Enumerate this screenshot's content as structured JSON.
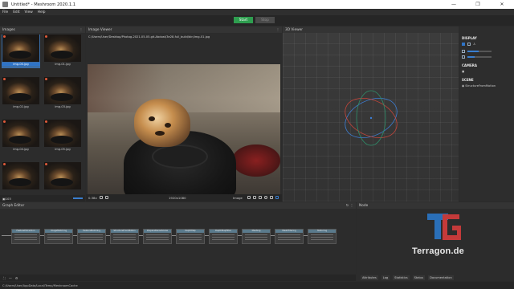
{
  "window": {
    "title": "Untitled* - Meshroom 2020.1.1",
    "controls": [
      "—",
      "❐",
      "✕"
    ]
  },
  "menu": [
    "File",
    "Edit",
    "View",
    "Help"
  ],
  "toolbar": {
    "start_label": "Start",
    "stop_label": "Stop"
  },
  "images_pane": {
    "title": "Images",
    "thumbnails": [
      "img-00.jpg",
      "img-01.jpg",
      "img-02.jpg",
      "img-03.jpg",
      "img-04.jpg",
      "img-05.jpg",
      "img-06.jpg",
      "img-07.jpg",
      "img-08.jpg",
      "img-09.jpg"
    ],
    "selected_index": 0,
    "count": "103"
  },
  "image_viewer": {
    "title": "Image Viewer",
    "path": "C:/Users/User/Desktop/Photog-2021-05-05-git-Abdost/3e28-full_build/bin/img-01.jpg",
    "zoom": "0.38x",
    "resolution": "1920x1080",
    "mode": "Image"
  },
  "viewer_3d": {
    "title": "3D Viewer"
  },
  "right_panel": {
    "display_label": "DISPLAY",
    "camera_label": "CAMERA",
    "scene_label": "SCENE",
    "scene_item": "StructureFromMotion",
    "slider_1": 0.45,
    "slider_2": 0.3
  },
  "graph_editor": {
    "title": "Graph Editor",
    "nodes": [
      "FeatureExtraction",
      "ImageMatching",
      "FeatureMatching",
      "StructureFromMotion",
      "PrepareDenseScene",
      "DepthMap",
      "DepthMapFilter",
      "Meshing",
      "MeshFiltering",
      "Texturing"
    ]
  },
  "node_pane": {
    "title": "Node",
    "logo_text": "Terragon.de",
    "tabs": [
      "Attributes",
      "Log",
      "Statistics",
      "Status",
      "Documentation"
    ]
  },
  "status": {
    "path": "C:/Users/User/AppData/Local/Temp/MeshroomCache"
  },
  "colors": {
    "accent": "#2f74c7",
    "start": "#2e9e4f",
    "logo_blue": "#2a6fb8",
    "logo_red": "#c43a3a"
  }
}
